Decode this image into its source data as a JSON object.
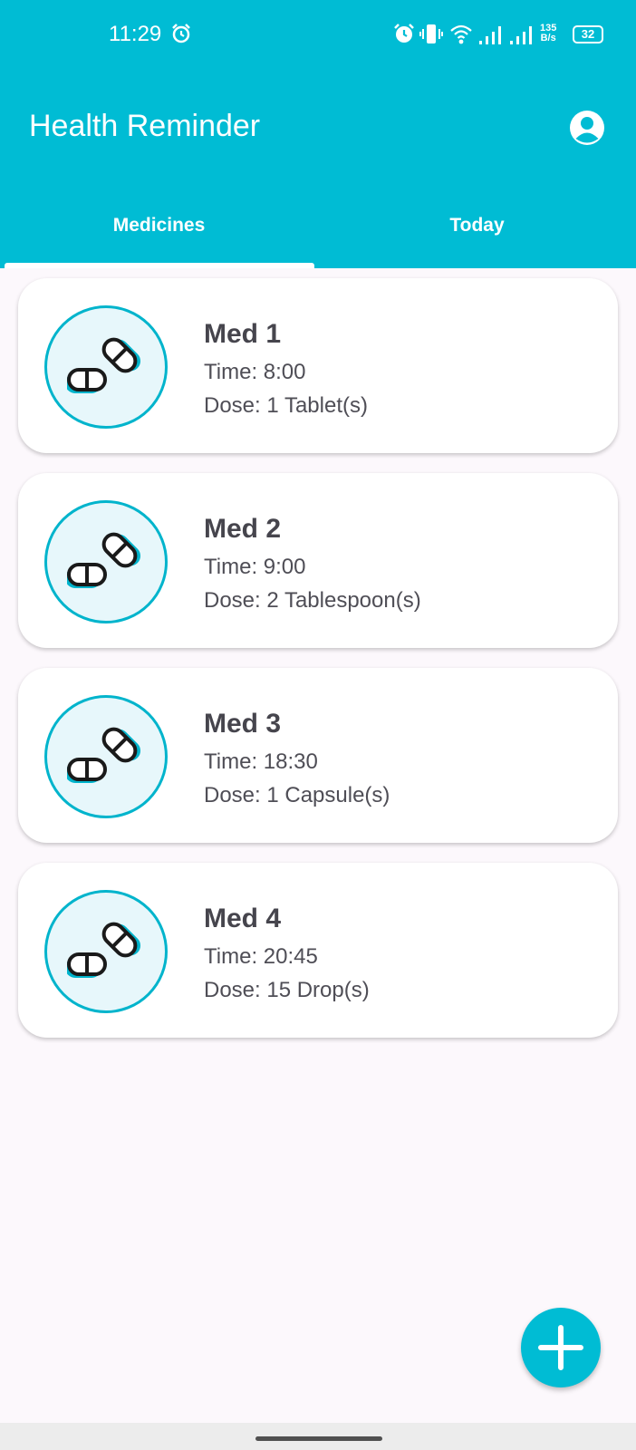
{
  "status_bar": {
    "time": "11:29",
    "net_speed_value": "135",
    "net_speed_unit": "B/s",
    "battery": "32",
    "icons": [
      "alarm-icon",
      "vibrate-icon",
      "wifi-icon",
      "signal-icon",
      "signal-icon"
    ]
  },
  "app_bar": {
    "title": "Health Reminder",
    "profile_icon": "account-circle-icon",
    "color": "#00bcd4"
  },
  "tabs": [
    {
      "label": "Medicines",
      "selected": true
    },
    {
      "label": "Today",
      "selected": false
    }
  ],
  "medicines": [
    {
      "name": "Med 1",
      "time": "Time: 8:00",
      "dose": "Dose: 1 Tablet(s)",
      "icon": "pills-icon"
    },
    {
      "name": "Med 2",
      "time": "Time: 9:00",
      "dose": "Dose: 2 Tablespoon(s)",
      "icon": "pills-icon"
    },
    {
      "name": "Med 3",
      "time": "Time: 18:30",
      "dose": "Dose: 1 Capsule(s)",
      "icon": "pills-icon"
    },
    {
      "name": "Med 4",
      "time": "Time: 20:45",
      "dose": "Dose: 15 Drop(s)",
      "icon": "pills-icon"
    }
  ],
  "fab": {
    "icon": "plus-icon"
  }
}
